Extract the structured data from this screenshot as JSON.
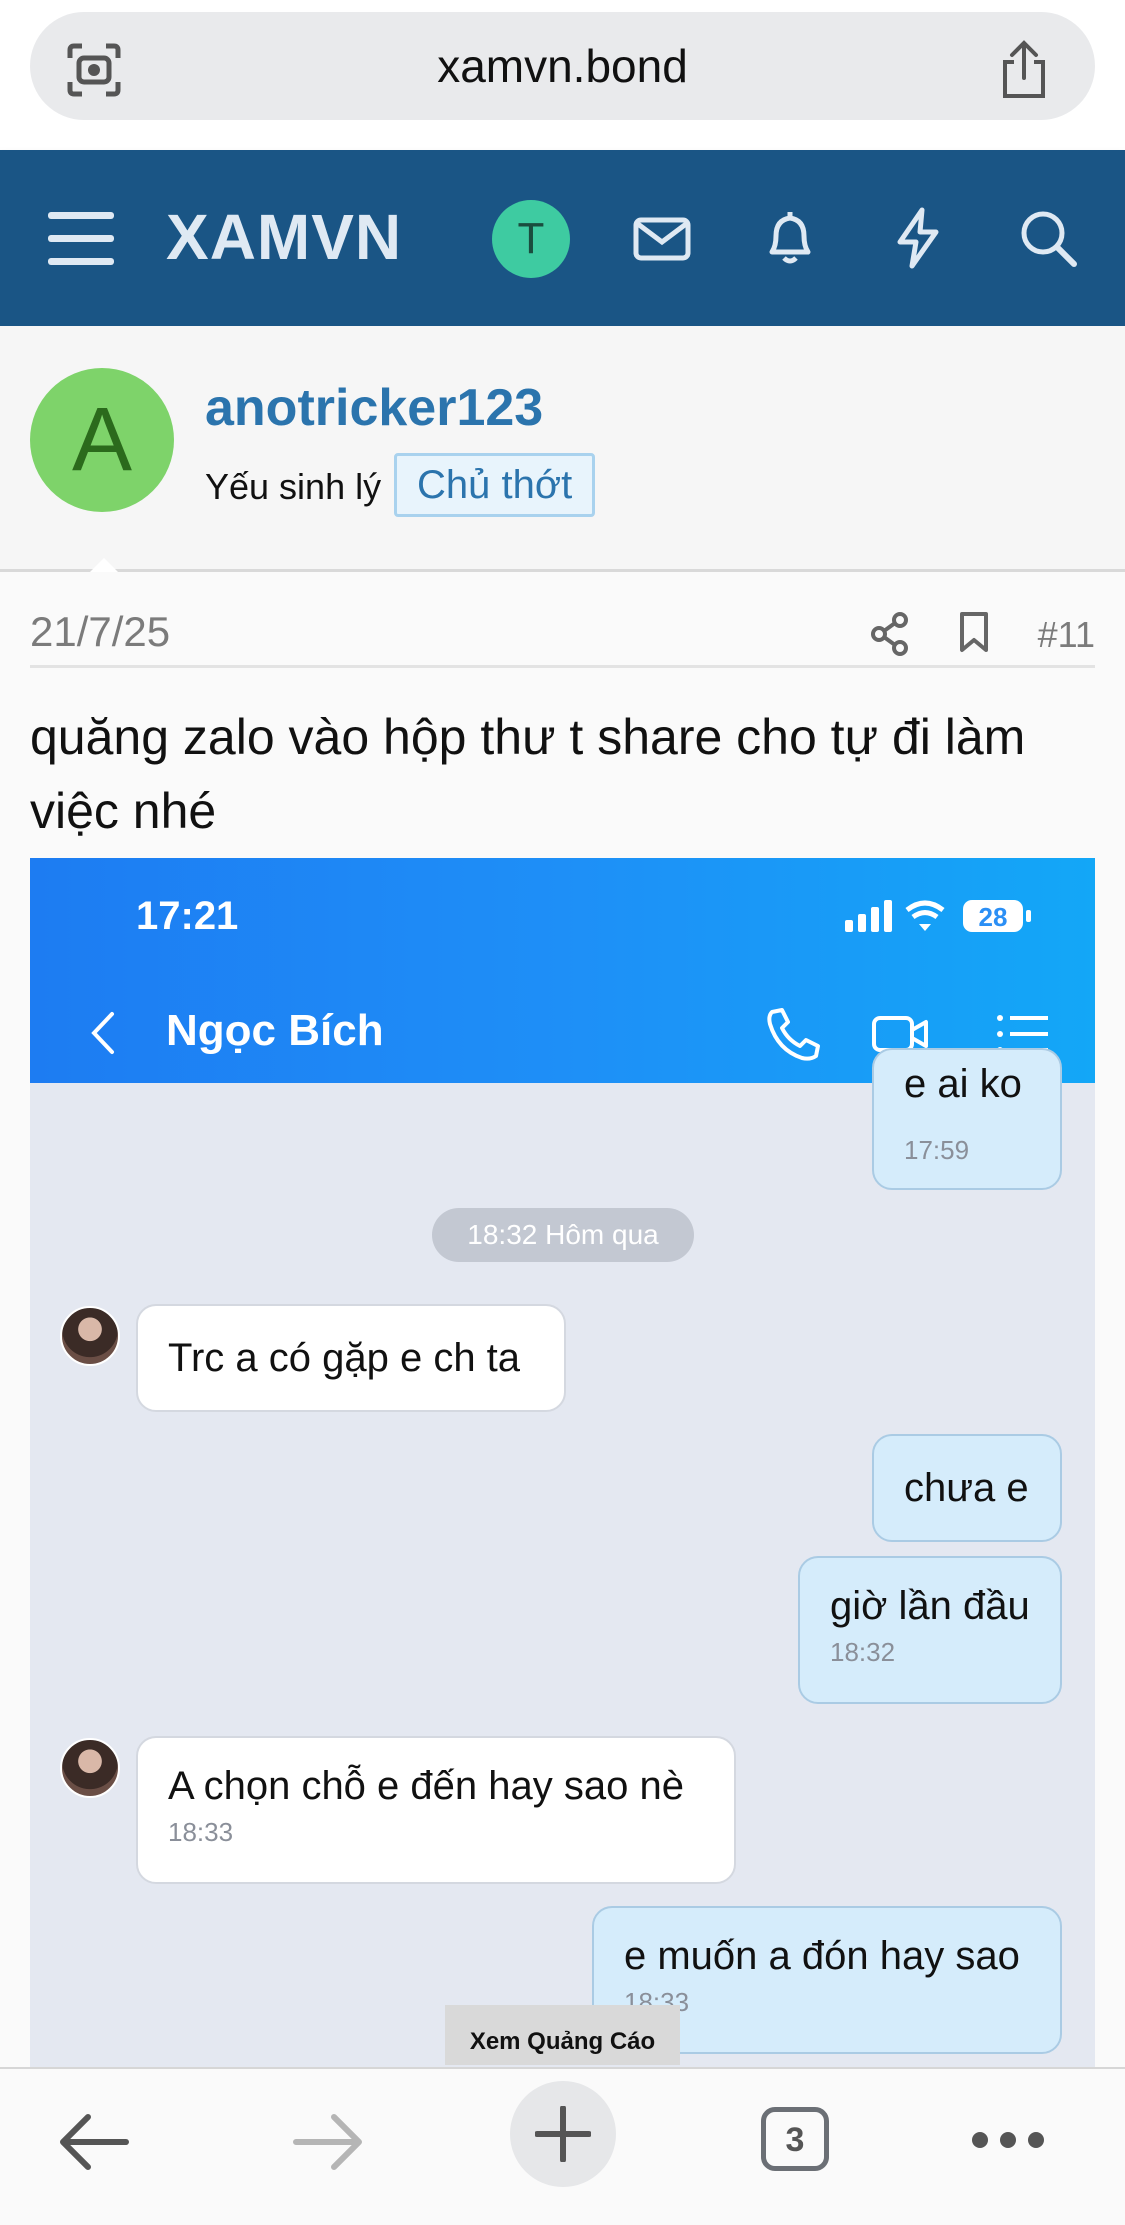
{
  "browser": {
    "url": "xamvn.bond",
    "icons": [
      "lens-icon",
      "share-icon"
    ]
  },
  "site": {
    "brand": "XAMVN",
    "user_initial": "T",
    "icons": [
      "hamburger-icon",
      "mail-icon",
      "bell-icon",
      "bolt-icon",
      "search-icon"
    ],
    "colors": {
      "header": "#1a5585",
      "avatar": "#3ecba1"
    }
  },
  "author": {
    "initial": "A",
    "username": "anotricker123",
    "title": "Yếu sinh lý",
    "badge": "Chủ thớt"
  },
  "post": {
    "date": "21/7/25",
    "number": "#11",
    "text": "quăng zalo vào hộp thư t share cho tự đi làm việc nhé"
  },
  "chat": {
    "status_time": "17:21",
    "battery": "28",
    "contact": "Ngọc Bích",
    "partial_text": "e ai ko",
    "first_time": "17:59",
    "date_chip": "18:32 Hôm qua",
    "messages": [
      {
        "dir": "in",
        "text": "Trc a có gặp e ch ta",
        "time": ""
      },
      {
        "dir": "out",
        "text": "chưa e",
        "time": ""
      },
      {
        "dir": "out",
        "text": "giờ lần đầu",
        "time": "18:32"
      },
      {
        "dir": "in",
        "text": "A chọn chỗ e đến hay sao nè",
        "time": "18:33"
      },
      {
        "dir": "out",
        "text": "e muốn a đón hay sao",
        "time": "18:33"
      }
    ]
  },
  "ad_label": "Xem Quảng Cáo",
  "toolbar": {
    "tab_count": "3",
    "icons": [
      "back-icon",
      "forward-icon",
      "plus-icon",
      "tabs-icon",
      "more-icon"
    ]
  }
}
